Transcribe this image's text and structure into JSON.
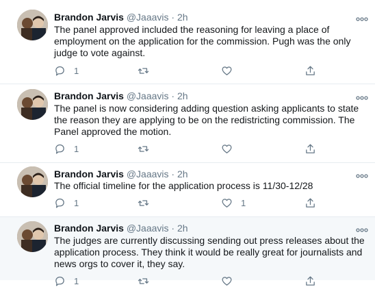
{
  "tweets": [
    {
      "author": "Brandon Jarvis",
      "handle": "@Jaaavis",
      "separator": "·",
      "time": "2h",
      "text": "The panel approved included the reasoning for leaving a place of employment on the application for the commission. Pugh was the only judge to vote against.",
      "reply_count": "1",
      "retweet_count": "",
      "like_count": ""
    },
    {
      "author": "Brandon Jarvis",
      "handle": "@Jaaavis",
      "separator": "·",
      "time": "2h",
      "text": "The panel is now considering adding question asking applicants to state the reason they are applying to be on the redistricting commission. The Panel approved the motion.",
      "reply_count": "1",
      "retweet_count": "",
      "like_count": ""
    },
    {
      "author": "Brandon Jarvis",
      "handle": "@Jaaavis",
      "separator": "·",
      "time": "2h",
      "text": "The official timeline for the application process is 11/30-12/28",
      "reply_count": "1",
      "retweet_count": "",
      "like_count": "1"
    },
    {
      "author": "Brandon Jarvis",
      "handle": "@Jaaavis",
      "separator": "·",
      "time": "2h",
      "text": "The judges are currently discussing sending out press releases about the application process. They think it would be really great for journalists and news orgs to cover it, they say.",
      "reply_count": "1",
      "retweet_count": "",
      "like_count": ""
    }
  ],
  "icons": {
    "reply": "reply-icon",
    "retweet": "retweet-icon",
    "like": "heart-icon",
    "share": "share-icon",
    "more": "more-icon"
  },
  "colors": {
    "text": "#14171a",
    "secondary": "#657786",
    "divider": "#e6ecf0",
    "highlight_bg": "#f5f8fa"
  }
}
